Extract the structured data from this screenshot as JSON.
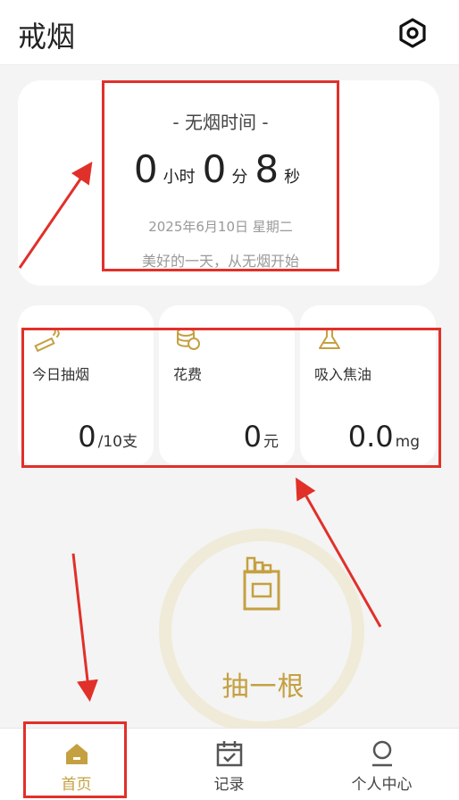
{
  "app_title": "戒烟",
  "timer": {
    "title": "- 无烟时间 -",
    "hours": "0",
    "hours_unit": "小时",
    "minutes": "0",
    "minutes_unit": "分",
    "seconds": "8",
    "seconds_unit": "秒",
    "date": "2025年6月10日 星期二",
    "motto": "美好的一天，从无烟开始"
  },
  "stats": [
    {
      "label": "今日抽烟",
      "value": "0",
      "unit": "/10支",
      "icon": "cigarette-icon"
    },
    {
      "label": "花费",
      "value": "0",
      "unit": "元",
      "icon": "coins-icon"
    },
    {
      "label": "吸入焦油",
      "value": "0.0",
      "unit": "mg",
      "icon": "flask-icon"
    }
  ],
  "smoke_button": {
    "label": "抽一根",
    "icon": "cigarette-pack-icon"
  },
  "tabs": [
    {
      "label": "首页",
      "icon": "home-icon",
      "active": true
    },
    {
      "label": "记录",
      "icon": "calendar-check-icon",
      "active": false
    },
    {
      "label": "个人中心",
      "icon": "user-icon",
      "active": false
    }
  ],
  "colors": {
    "accent": "#c4a040",
    "annotation_red": "#e1302a",
    "ring": "#f0ebd8"
  }
}
